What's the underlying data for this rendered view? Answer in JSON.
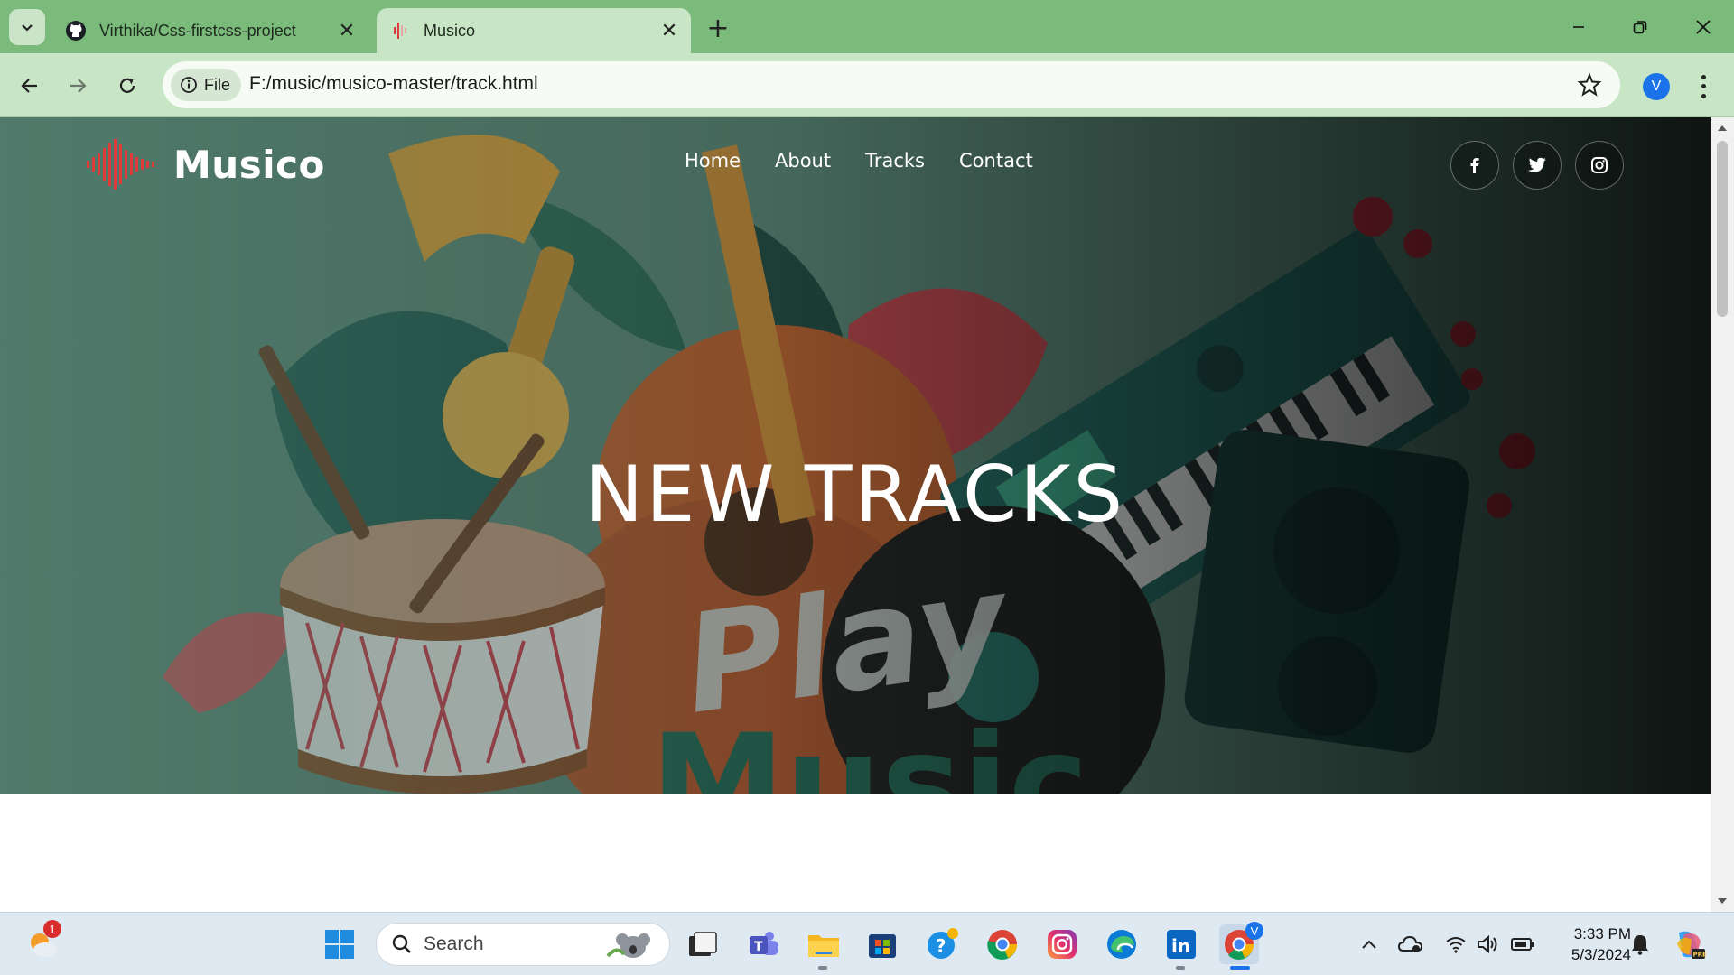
{
  "browser": {
    "tabs": [
      {
        "title": "Virthika/Css-firstcss-project",
        "icon": "github-icon",
        "active": false
      },
      {
        "title": "Musico",
        "icon": "musico-favicon",
        "active": true
      }
    ],
    "new_tab": "+",
    "address": {
      "chip_label": "File",
      "url": "F:/music/musico-master/track.html"
    },
    "profile_initial": "V"
  },
  "site": {
    "brand": "Musico",
    "nav": [
      "Home",
      "About",
      "Tracks",
      "Contact"
    ],
    "social": [
      "facebook-icon",
      "twitter-icon",
      "instagram-icon"
    ],
    "hero_title": "NEW TRACKS",
    "accent_color": "#e03b3b"
  },
  "taskbar": {
    "search_placeholder": "Search",
    "notification_count": "1",
    "chrome_profile_badge": "V",
    "time": "3:33 PM",
    "date": "5/3/2024",
    "pinned": [
      "weather-icon",
      "windows-start-icon",
      "search-icon",
      "task-view-icon",
      "teams-icon",
      "file-explorer-icon",
      "microsoft-store-icon",
      "help-icon",
      "chrome-icon",
      "instagram-icon",
      "edge-icon",
      "linkedin-icon",
      "chrome-active-icon"
    ]
  }
}
